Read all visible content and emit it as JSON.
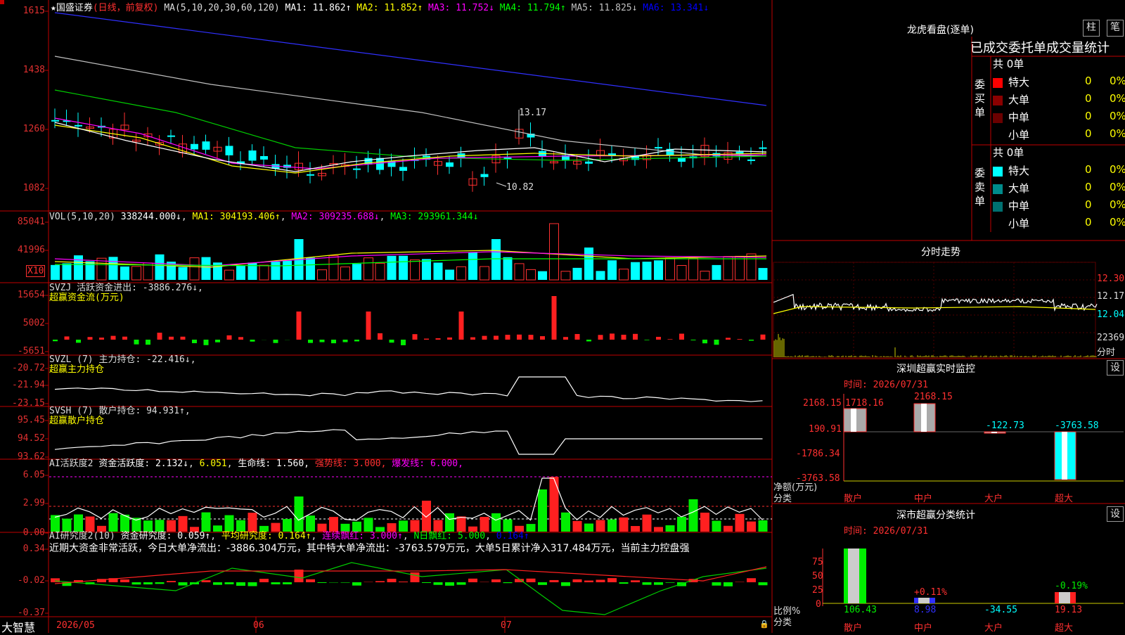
{
  "stock": {
    "star": "★",
    "name": "国盛证券",
    "mode": "(日线，前复权)",
    "ma_title": "MA(5,10,20,30,60,120)",
    "ma": [
      {
        "label": "MA1:",
        "value": "11.862↑",
        "color": "#ffffff"
      },
      {
        "label": "MA2:",
        "value": "11.852↑",
        "color": "#ffff00"
      },
      {
        "label": "MA3:",
        "value": "11.752↓",
        "color": "#ff00ff"
      },
      {
        "label": "MA4:",
        "value": "11.794↑",
        "color": "#00ff00"
      },
      {
        "label": "MA5:",
        "value": "11.825↓",
        "color": "#c0c0c0"
      },
      {
        "label": "MA6:",
        "value": "13.341↓",
        "color": "#0000ff"
      }
    ]
  },
  "main_axis": [
    "1615",
    "1438",
    "1260",
    "1082"
  ],
  "annotations": {
    "high": "13.17",
    "low": "10.82"
  },
  "vol": {
    "title": "VOL(5,10,20)",
    "value": "338244.000↓",
    "ma1": "MA1: 304193.406↑",
    "ma2": "MA2: 309235.688↓",
    "ma3": "MA3: 293961.344↓",
    "axis": [
      "85041",
      "41996"
    ],
    "unit": "X10"
  },
  "svzj": {
    "title": "SVZJ  活跃资金进出: -3886.276↓,",
    "sub": "超赢资金流(万元)",
    "axis": [
      "15654",
      "5002",
      "-5651"
    ]
  },
  "svzl": {
    "title": "SVZL (7) 主力持仓: -22.416↓,",
    "sub": "超赢主力持仓",
    "axis": [
      "-20.72",
      "-21.94",
      "-23.15"
    ]
  },
  "svsh": {
    "title": "SVSH (7) 散户持仓: 94.931↑,",
    "sub": "超赢散户持仓",
    "axis": [
      "95.45",
      "94.52",
      "93.62"
    ]
  },
  "ai1": {
    "title": "AI活跃度2",
    "t1": "资金活跃度: 2.132↓",
    "t2": "6.051",
    "t3": "生命线: 1.560,",
    "t4": "强势线: 3.000,",
    "t5": "爆发线: 6.000,",
    "axis": [
      "6.05",
      "2.99",
      "0.00"
    ]
  },
  "ai2": {
    "title": "AI研究度2(10)",
    "t1": "资金研究度: 0.059↑",
    "t2": "平均研究度: 0.164↑",
    "t3": "连续飘红: 3.000↑",
    "t4": "N日飘红: 5.000",
    "t5": "0.164↑",
    "comment": "近期大资金非常活跃，今日大单净流出：-3886.304万元，其中特大单净流出：-3763.579万元，大单5日累计净入317.484万元，当前主力控盘强",
    "axis": [
      "0.34",
      "-0.02",
      "-0.37"
    ]
  },
  "bottom": {
    "brand": "大智慧",
    "dates": [
      "2026/05",
      "06",
      "07"
    ]
  },
  "dragon": {
    "title": "龙虎看盘(逐单)",
    "btn1": "柱",
    "btn2": "笔",
    "subtitle": "已成交委托单成交量统计",
    "buy": {
      "side": "委买单",
      "total": "共 0单",
      "rows": [
        {
          "name": "特大",
          "count": "0",
          "pct": "0%",
          "color": "#ff0000"
        },
        {
          "name": "大单",
          "count": "0",
          "pct": "0%",
          "color": "#8b0000"
        },
        {
          "name": "中单",
          "count": "0",
          "pct": "0%",
          "color": "#6b0000"
        },
        {
          "name": "小单",
          "count": "0",
          "pct": "0%",
          "color": "#000000"
        }
      ]
    },
    "sell": {
      "side": "委卖单",
      "total": "共 0单",
      "rows": [
        {
          "name": "特大",
          "count": "0",
          "pct": "0%",
          "color": "#00ffff"
        },
        {
          "name": "大单",
          "count": "0",
          "pct": "0%",
          "color": "#008b8b"
        },
        {
          "name": "中单",
          "count": "0",
          "pct": "0%",
          "color": "#007070"
        },
        {
          "name": "小单",
          "count": "0",
          "pct": "0%",
          "color": "#000000"
        }
      ]
    }
  },
  "intraday": {
    "title": "分时走势",
    "p1": "12.30",
    "p2": "12.17",
    "p3": "12.04",
    "vol": "22369",
    "unit": "分时"
  },
  "monitor": {
    "title": "深圳超赢实时监控",
    "btn": "设",
    "time": "时间: 2026/07/31",
    "axis": [
      "2168.15",
      "190.91",
      "-1786.34",
      "-3763.58"
    ],
    "ylabel": "净额(万元)",
    "xlabel": "分类",
    "bars": [
      {
        "cat": "散户",
        "value": "1718.16"
      },
      {
        "cat": "中户",
        "value": "2168.15"
      },
      {
        "cat": "大户",
        "value": "-122.73"
      },
      {
        "cat": "超大",
        "value": "-3763.58"
      }
    ]
  },
  "classify": {
    "title": "深市超赢分类统计",
    "btn": "设",
    "time": "时间: 2026/07/31",
    "axis": [
      "75",
      "50",
      "25",
      "0"
    ],
    "ylabel": "比例%",
    "xlabel": "分类",
    "bars": [
      {
        "cat": "散户",
        "value": "106.43",
        "top": ""
      },
      {
        "cat": "中户",
        "value": "8.98",
        "top": "+0.11%"
      },
      {
        "cat": "大户",
        "value": "-34.55",
        "top": ""
      },
      {
        "cat": "超大",
        "value": "19.13",
        "top": "-0.19%"
      }
    ]
  }
}
